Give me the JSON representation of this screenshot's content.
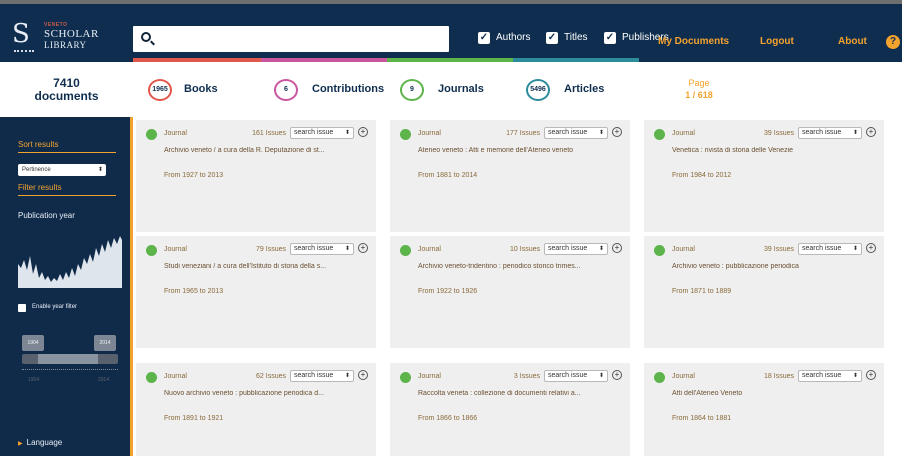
{
  "app": {
    "logo_tag": "VENETO",
    "logo_line1": "SCHOLAR",
    "logo_line2": "LIBRARY"
  },
  "header": {
    "search_value": "",
    "search_placeholder": "",
    "checks": [
      {
        "label": "Authors",
        "checked": true
      },
      {
        "label": "Titles",
        "checked": true
      },
      {
        "label": "Publishers",
        "checked": true
      }
    ],
    "nav": {
      "my_documents": "My Documents",
      "logout": "Logout",
      "about": "About"
    },
    "help_glyph": "?"
  },
  "summary": {
    "count": "7410",
    "count_label": "documents",
    "facets": [
      {
        "count": "1965",
        "label": "Books",
        "color": "#e2574c"
      },
      {
        "count": "6",
        "label": "Contributions",
        "color": "#c9569e"
      },
      {
        "count": "9",
        "label": "Journals",
        "color": "#5cb44b"
      },
      {
        "count": "5496",
        "label": "Articles",
        "color": "#2c8c9c"
      }
    ],
    "page_label": "Page",
    "page_value": "1 / 618"
  },
  "sidebar": {
    "sort_heading": "Sort results",
    "sort_value": "Pertinence",
    "filter_heading": "Filter results",
    "pub_year": "Publication year",
    "enable_year_filter": "Enable year filter",
    "slider_from": "1904",
    "slider_to": "2014",
    "language": "Language"
  },
  "cards": [
    {
      "type": "Journal",
      "issues": "161 Issues",
      "select": "search issue",
      "title": "Archivio veneto / a cura della R. Deputazione di st...",
      "range": "From 1927 to 2013"
    },
    {
      "type": "Journal",
      "issues": "177 Issues",
      "select": "search issue",
      "title": "Ateneo veneto : Atti e memorie dell'Ateneo veneto",
      "range": "From 1881 to 2014"
    },
    {
      "type": "Journal",
      "issues": "39 Issues",
      "select": "search issue",
      "title": "Venetica : rivista di storia delle Venezie",
      "range": "From 1984 to 2012"
    },
    {
      "type": "Journal",
      "issues": "79 Issues",
      "select": "search issue",
      "title": "Studi veneziani / a cura dell'Istituto di storia della s...",
      "range": "From 1965 to 2013"
    },
    {
      "type": "Journal",
      "issues": "10 Issues",
      "select": "search issue",
      "title": "Archivio veneto-tridentino : periodico storico trimes...",
      "range": "From 1922 to 1926"
    },
    {
      "type": "Journal",
      "issues": "39 Issues",
      "select": "search issue",
      "title": "Archivio veneto : pubblicazione periodica",
      "range": "From 1871 to 1889"
    },
    {
      "type": "Journal",
      "issues": "62 Issues",
      "select": "search issue",
      "title": "Nuovo archivio veneto : pubblicazione periodica d...",
      "range": "From 1891 to 1921"
    },
    {
      "type": "Journal",
      "issues": "3 Issues",
      "select": "search issue",
      "title": "Raccolta veneta : collezione di documenti relativi a...",
      "range": "From 1866 to 1866"
    },
    {
      "type": "Journal",
      "issues": "18 Issues",
      "select": "search issue",
      "title": "Atti dell'Ateneo Veneto",
      "range": "From 1864 to 1881"
    }
  ]
}
